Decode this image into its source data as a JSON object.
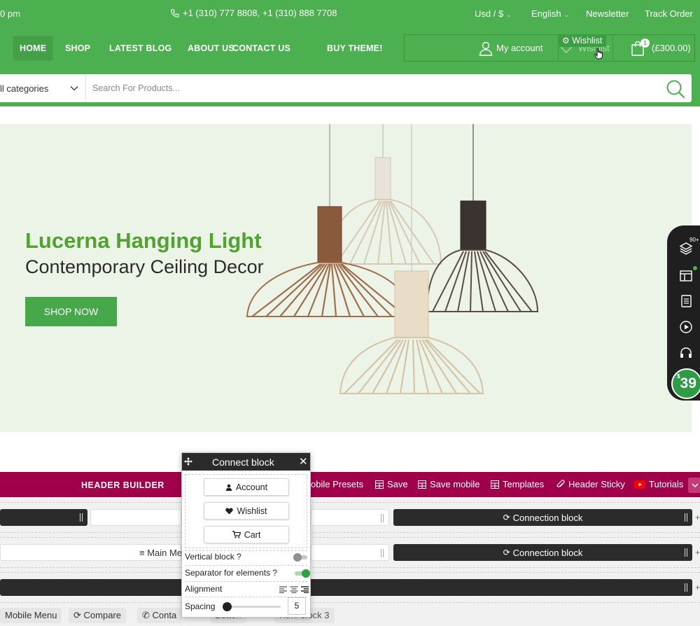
{
  "topbar": {
    "left_text": "0 pm",
    "phones": "+1 (310) 777 8808, +1 (310) 888 7708",
    "currency": "Usd / $",
    "language": "English",
    "newsletter": "Newsletter",
    "track_order": "Track Order"
  },
  "nav": {
    "items": [
      "HOME",
      "SHOP",
      "LATEST BLOG",
      "ABOUT US",
      "CONTACT US",
      "BUY THEME!"
    ],
    "my_account": "My account",
    "wishlist_hint": "Wishlist",
    "wishlist_tag": "Wishlist",
    "cart_count": "1",
    "cart_total": "(£300.00)"
  },
  "search": {
    "category": "ll categories",
    "placeholder": "Search For Products..."
  },
  "hero": {
    "title": "Lucerna Hanging Light",
    "subtitle": "Contemporary Ceiling Decor",
    "cta": "SHOP NOW"
  },
  "side_panel": {
    "badge": "90+",
    "price_symbol": "$",
    "price": "39"
  },
  "header_builder": {
    "title": "HEADER BUILDER",
    "items": [
      "obile Presets",
      "Save",
      "Save mobile",
      "Templates",
      "Header Sticky",
      "Tutorials"
    ],
    "row1_right": "Connection block",
    "row2_center": "Main Me",
    "row2_right": "Connection block"
  },
  "bottom_chips": [
    "Mobile Menu",
    "Compare",
    "Conta",
    "Button",
    "Html block 3"
  ],
  "popup": {
    "title": "Connect block",
    "buttons": [
      "Account",
      "Wishlist",
      "Cart"
    ],
    "vertical_label": "Vertical block ?",
    "separator_label": "Separator for elements ?",
    "alignment_label": "Alignment",
    "spacing_label": "Spacing",
    "spacing_value": "5"
  },
  "colors": {
    "brand_green": "#4caf50",
    "hero_title_green": "#4fa32e",
    "builder_bar": "#a0004a",
    "hero_bg": "#ecf4e8"
  }
}
